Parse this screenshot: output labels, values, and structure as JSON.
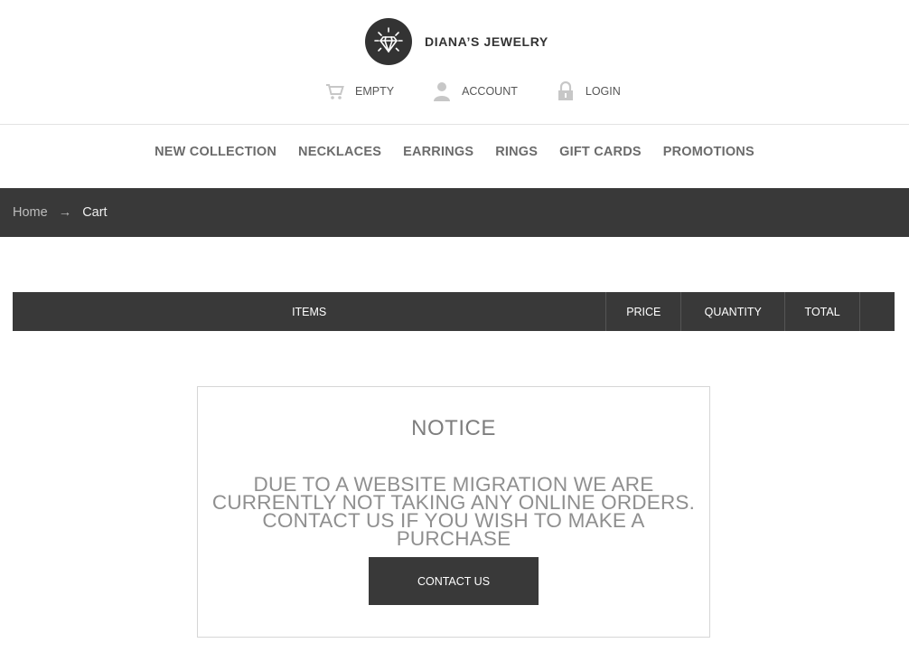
{
  "brand": {
    "name": "DIANA’S JEWELRY",
    "logo_icon": "diamond-icon"
  },
  "user_links": [
    {
      "label": "EMPTY",
      "icon": "cart-icon"
    },
    {
      "label": "ACCOUNT",
      "icon": "user-icon"
    },
    {
      "label": "LOGIN",
      "icon": "lock-icon"
    }
  ],
  "nav": [
    "NEW COLLECTION",
    "NECKLACES",
    "EARRINGS",
    "RINGS",
    "GIFT CARDS",
    "PROMOTIONS"
  ],
  "breadcrumb": {
    "home": "Home",
    "separator": "→",
    "current": "Cart"
  },
  "cart_table": {
    "columns": [
      "ITEMS",
      "PRICE",
      "QUANTITY",
      "TOTAL",
      ""
    ]
  },
  "notice": {
    "title": "NOTICE",
    "message": "DUE TO A WEBSITE MIGRATION WE ARE CURRENTLY NOT TAKING ANY ONLINE ORDERS. CONTACT US IF YOU WISH TO MAKE A PURCHASE",
    "button_label": "CONTACT US"
  },
  "colors": {
    "dark_bar": "#393939",
    "logo_bg": "#333333",
    "nav_text": "#6b6b6b",
    "notice_text": "#8f8f8f"
  }
}
